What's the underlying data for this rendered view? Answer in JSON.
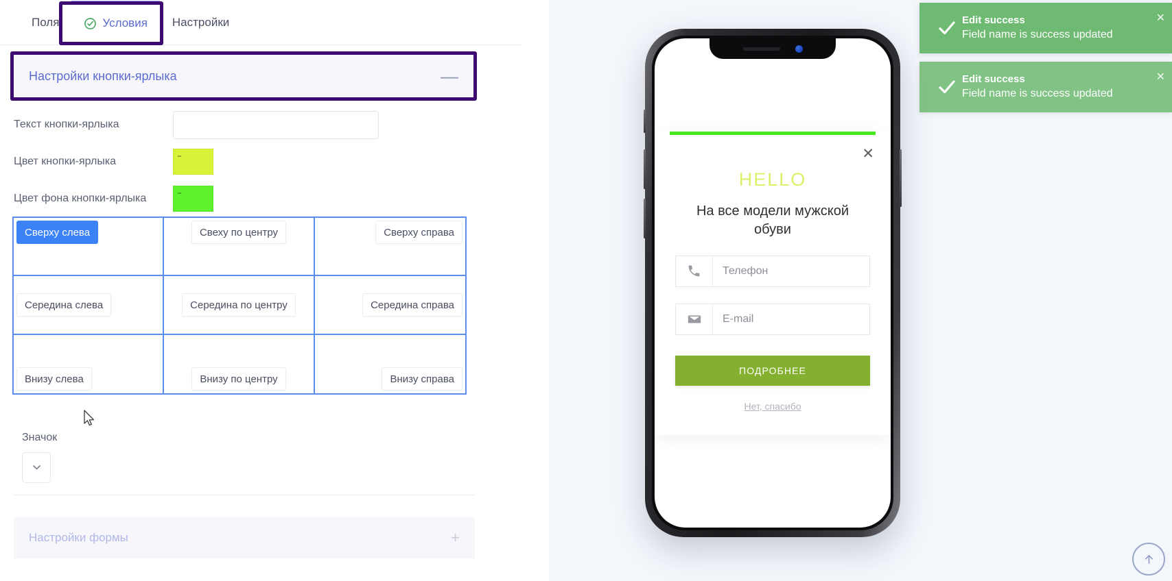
{
  "tabs": [
    {
      "label": "Поля",
      "icon": "",
      "active": false
    },
    {
      "label": "Условия",
      "icon": "check-circle-icon",
      "active": true
    },
    {
      "label": "Настройки",
      "icon": "",
      "active": false
    }
  ],
  "section": {
    "title": "Настройки кнопки-ярлыка",
    "collapse_symbol": "—"
  },
  "fields": {
    "text_label": "Текст кнопки-ярлыка",
    "text_value": "",
    "text_placeholder": "",
    "color_label": "Цвет кнопки-ярлыка",
    "color_value": "#d8f23a",
    "bg_label": "Цвет фона кнопки-ярлыка",
    "bg_value": "#5ef22e"
  },
  "position_grid": {
    "cells": [
      {
        "label": "Сверху слева",
        "selected": true
      },
      {
        "label": "Свеху по центру",
        "selected": false
      },
      {
        "label": "Сверху справа",
        "selected": false
      },
      {
        "label": "Середина слева",
        "selected": false
      },
      {
        "label": "Середина по центру",
        "selected": false
      },
      {
        "label": "Середина справа",
        "selected": false
      },
      {
        "label": "Внизу слева",
        "selected": false
      },
      {
        "label": "Внизу по центру",
        "selected": false
      },
      {
        "label": "Внизу справа",
        "selected": false
      }
    ]
  },
  "icon_block": {
    "label": "Значок",
    "selected": ""
  },
  "next_section": {
    "title": "Настройки формы",
    "expand_symbol": "+"
  },
  "preview": {
    "popup": {
      "hello": "HELLO",
      "subtitle": "На все модели мужской обуви",
      "close_symbol": "✕",
      "phone_placeholder": "Телефон",
      "email_placeholder": "E-mail",
      "cta_label": "ПОДРОБНЕЕ",
      "decline_label": "Нет, спасибо",
      "accent_bar_color": "#49e821",
      "hello_color": "#d9f26a",
      "cta_color": "#83b02e"
    }
  },
  "toasts": [
    {
      "title": "Edit success",
      "message": "Field name is success updated",
      "close_symbol": "✕"
    },
    {
      "title": "Edit success",
      "message": "Field name is success updated",
      "close_symbol": "✕"
    }
  ],
  "scroll_top": {
    "symbol": "↑"
  }
}
